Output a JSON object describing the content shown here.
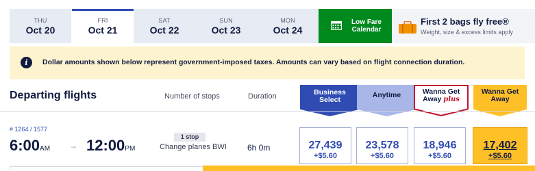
{
  "date_tabs": [
    {
      "dow": "THU",
      "date": "Oct 20"
    },
    {
      "dow": "FRI",
      "date": "Oct 21",
      "selected": true
    },
    {
      "dow": "SAT",
      "date": "Oct 22"
    },
    {
      "dow": "SUN",
      "date": "Oct 23"
    },
    {
      "dow": "MON",
      "date": "Oct 24"
    }
  ],
  "low_fare": {
    "line1": "Low Fare",
    "line2": "Calendar",
    "icon": "calendar-icon"
  },
  "bags": {
    "title": "First 2 bags fly free®",
    "subtitle": "Weight, size & excess limits apply",
    "icon": "luggage-icon"
  },
  "banner": {
    "text": "Dollar amounts shown below represent government-imposed taxes. Amounts can vary based on flight connection duration.",
    "icon": "info-icon"
  },
  "header": {
    "title": "Departing flights",
    "stops_label": "Number of stops",
    "duration_label": "Duration"
  },
  "fare_classes": {
    "business": {
      "line1": "Business",
      "line2": "Select"
    },
    "anytime": {
      "line1": "Anytime"
    },
    "wanna_plus": {
      "line1": "Wanna Get",
      "line2": "Away",
      "plus": "plus"
    },
    "wanna": {
      "line1": "Wanna Get",
      "line2": "Away"
    }
  },
  "flight": {
    "number": "# 1264 / 1577",
    "depart_time": "6:00",
    "depart_ampm": "AM",
    "arrow": "→",
    "arrive_time": "12:00",
    "arrive_ampm": "PM",
    "stops": "1 stop",
    "stops_detail": "Change planes BWI",
    "duration": "6h 0m",
    "fares": {
      "business": {
        "price": "27,439",
        "tax": "+$5.60"
      },
      "anytime": {
        "price": "23,578",
        "tax": "+$5.60"
      },
      "wanna_plus": {
        "price": "18,946",
        "tax": "+$5.60"
      },
      "wanna": {
        "price": "17,402",
        "tax": "+$5.60"
      }
    }
  },
  "colors": {
    "navy": "#111b40",
    "blue": "#304cb2",
    "yellow": "#ffbf27",
    "green": "#008a1e",
    "red": "#c4122f",
    "banner_bg": "#fdf4cf"
  }
}
